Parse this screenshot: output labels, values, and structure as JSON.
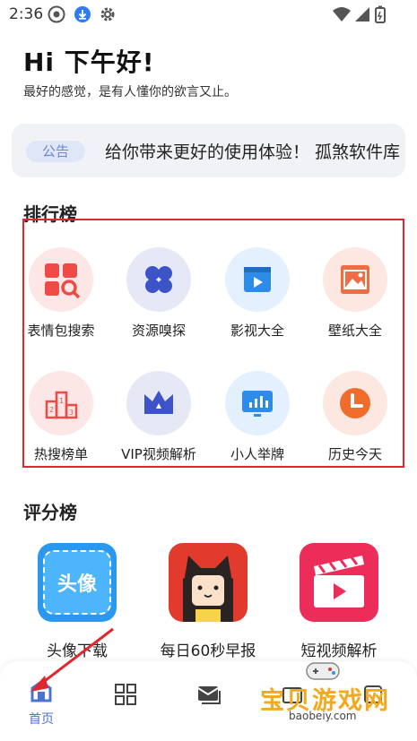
{
  "status_bar": {
    "time": "2:36"
  },
  "greeting": {
    "title": "Hi 下午好!",
    "subtitle": "最好的感觉，是有人懂你的欲言又止。"
  },
  "notice": {
    "badge": "公告",
    "text": "给你带来更好的使用体验！  孤煞软件库"
  },
  "ranking": {
    "title": "排行榜",
    "items": [
      {
        "label": "表情包搜索",
        "icon": "emoji-search-icon"
      },
      {
        "label": "资源嗅探",
        "icon": "resource-sniff-icon"
      },
      {
        "label": "影视大全",
        "icon": "video-play-icon"
      },
      {
        "label": "壁纸大全",
        "icon": "wallpaper-icon"
      },
      {
        "label": "热搜榜单",
        "icon": "podium-icon"
      },
      {
        "label": "VIP视频解析",
        "icon": "crown-icon"
      },
      {
        "label": "小人举牌",
        "icon": "board-chart-icon"
      },
      {
        "label": "历史今天",
        "icon": "clock-icon"
      }
    ]
  },
  "score": {
    "title": "评分榜",
    "apps": [
      {
        "label": "头像下载",
        "icon": "avatar-download-app-icon",
        "icon_text": "头像"
      },
      {
        "label": "每日60秒早报",
        "icon": "daily-news-app-icon"
      },
      {
        "label": "短视频解析",
        "icon": "short-video-app-icon"
      }
    ]
  },
  "nav": {
    "home_label": "首页"
  },
  "watermark": {
    "title": "宝贝游戏网",
    "url": "baobeiy.com"
  },
  "colors": {
    "accent": "#4c73d1",
    "highlight_border": "#e0262f",
    "icon_red": "#f04a3e",
    "icon_blue": "#3d53c8"
  }
}
